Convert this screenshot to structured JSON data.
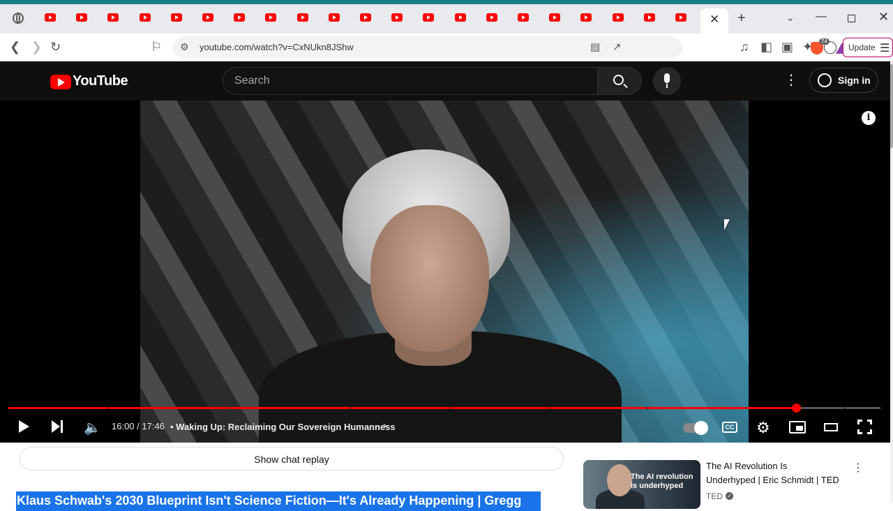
{
  "browser": {
    "tab_count": 21,
    "active_tab_close": "✕",
    "new_tab": "+",
    "tab_search": "⌄",
    "address": "youtube.com/watch?v=CxNUkn8JShw",
    "brave_shield_count": "74",
    "update_label": "Update"
  },
  "youtube": {
    "logo_text": "YouTube",
    "search_placeholder": "Search",
    "sign_in_label": "Sign in"
  },
  "player": {
    "time_display": "16:00 / 17:46",
    "chapter_title": "• Waking Up: Reclaiming Our Sovereign Humanness",
    "progress": 0.903,
    "chapter_marks": [
      0.113,
      0.253,
      0.393,
      0.506,
      0.619,
      0.732,
      0.845,
      0.958
    ],
    "info_label": "i",
    "cc_label": "CC"
  },
  "below": {
    "chat_replay_label": "Show chat replay",
    "video_title": "Klaus Schwab's 2030 Blueprint Isn't Science Fiction—It's Already Happening | Gregg"
  },
  "recommendation": {
    "thumb_line1": "The AI revolution",
    "thumb_line2": "is underhyped",
    "title_line1": "The AI Revolution Is",
    "title_line2": "Underhyped | Eric Schmidt | TED",
    "channel": "TED"
  },
  "colors": {
    "brand_red": "#ff0000",
    "yt_dark": "#0f0f0f",
    "selection_blue": "#1a73e8",
    "browser_accent": "#1a7f83"
  }
}
